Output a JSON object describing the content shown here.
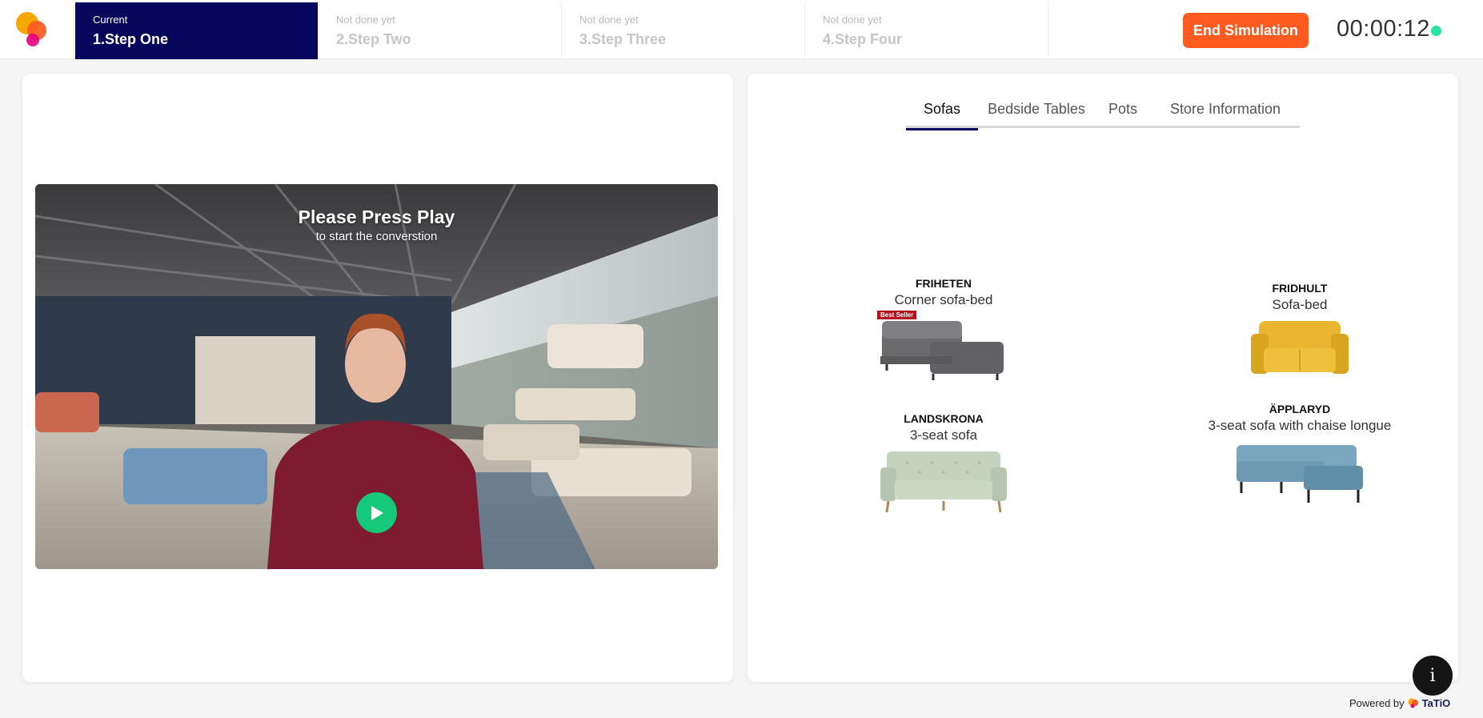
{
  "header": {
    "steps": [
      {
        "status": "Current",
        "name": "1.Step One"
      },
      {
        "status": "Not done yet",
        "name": "2.Step Two"
      },
      {
        "status": "Not done yet",
        "name": "3.Step Three"
      },
      {
        "status": "Not done yet",
        "name": "4.Step Four"
      }
    ],
    "end_button": "End Simulation",
    "timer": "00:00:12",
    "colors": {
      "active_step": "#07055c",
      "end_button": "#ff5a1f",
      "live_dot": "#2be3a0"
    }
  },
  "video": {
    "title": "Please Press Play",
    "subtitle": "to start the converstion",
    "play_icon": "play-icon",
    "play_color": "#14c97a"
  },
  "catalog": {
    "tabs": [
      "Sofas",
      "Bedside Tables",
      "Pots",
      "Store Information"
    ],
    "active_tab": "Sofas",
    "products": [
      {
        "name": "FRIHETEN",
        "desc": "Corner sofa-bed",
        "badge": "Best Seller",
        "color": "#6b6b6e"
      },
      {
        "name": "FRIDHULT",
        "desc": "Sofa-bed",
        "color": "#e8b630"
      },
      {
        "name": "LANDSKRONA",
        "desc": "3-seat sofa",
        "color": "#c5d1bd"
      },
      {
        "name": "ÄPPLARYD",
        "desc": "3-seat sofa with chaise longue",
        "color": "#6c9ab3"
      }
    ]
  },
  "footer": {
    "info_icon": "info-icon",
    "powered_by": "Powered by",
    "brand": "TaTiO"
  }
}
